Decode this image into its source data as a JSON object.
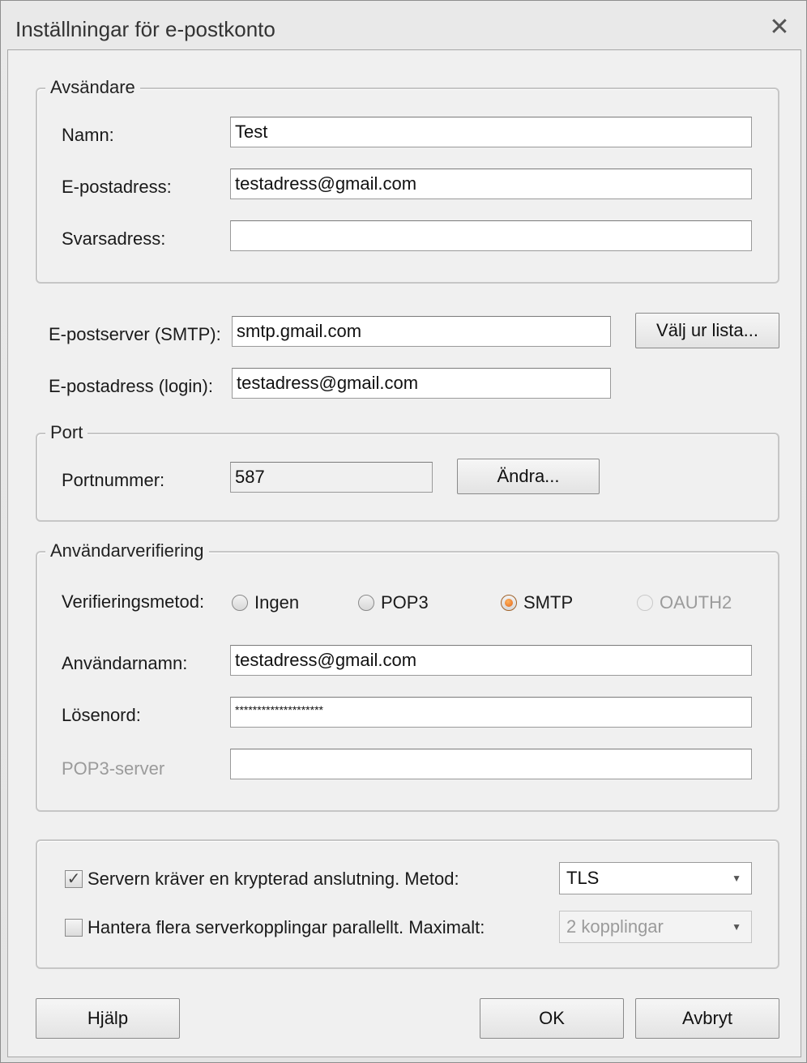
{
  "window": {
    "title": "Inställningar för e-postkonto"
  },
  "sender": {
    "legend": "Avsändare",
    "name_label": "Namn:",
    "name_value": "Test",
    "email_label": "E-postadress:",
    "email_value": "testadress@gmail.com",
    "reply_label": "Svarsadress:",
    "reply_value": ""
  },
  "server": {
    "smtp_label": "E-postserver (SMTP):",
    "smtp_value": "smtp.gmail.com",
    "choose_button": "Välj ur lista...",
    "login_label": "E-postadress (login):",
    "login_value": "testadress@gmail.com"
  },
  "port": {
    "legend": "Port",
    "label": "Portnummer:",
    "value": "587",
    "change_button": "Ändra..."
  },
  "auth": {
    "legend": "Användarverifiering",
    "method_label": "Verifieringsmetod:",
    "options": [
      "Ingen",
      "POP3",
      "SMTP",
      "OAUTH2"
    ],
    "selected": "SMTP",
    "username_label": "Användarnamn:",
    "username_value": "testadress@gmail.com",
    "password_label": "Lösenord:",
    "password_value": "********************",
    "pop3_label": "POP3-server",
    "pop3_value": ""
  },
  "security": {
    "encrypted_label": "Servern kräver en krypterad anslutning. Metod:",
    "encrypted_checked": true,
    "method_value": "TLS",
    "parallel_label": "Hantera flera serverkopplingar parallellt. Maximalt:",
    "parallel_checked": false,
    "parallel_value": "2 kopplingar"
  },
  "buttons": {
    "help": "Hjälp",
    "ok": "OK",
    "cancel": "Avbryt"
  }
}
